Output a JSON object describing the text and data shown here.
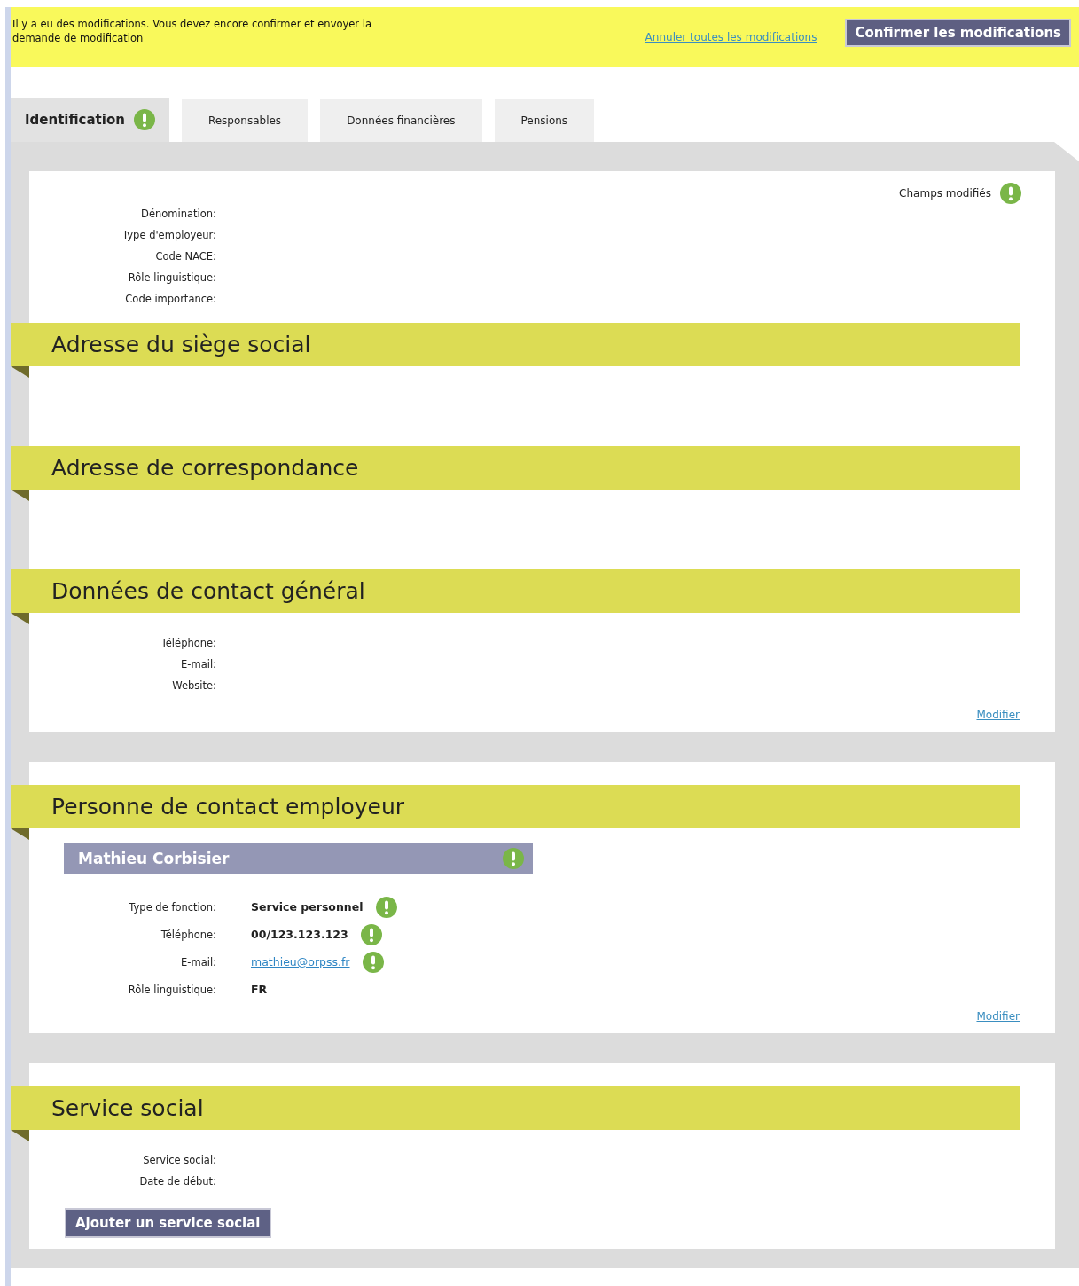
{
  "banner": {
    "message": "Il y a eu des modifications. Vous devez encore confirmer et envoyer la demande de modification",
    "cancel_link": "Annuler toutes les modifications",
    "confirm_button": "Confirmer les modifications"
  },
  "tabs": [
    {
      "label": "Identification",
      "selected": true,
      "modified": true
    },
    {
      "label": "Responsables",
      "selected": false,
      "modified": false
    },
    {
      "label": "Données financières",
      "selected": false,
      "modified": false
    },
    {
      "label": "Pensions",
      "selected": false,
      "modified": false
    }
  ],
  "cards": [
    {
      "legend": "Champs modifiés",
      "blocks": [
        {
          "kind": "fields",
          "fields": [
            {
              "label": "Dénomination:"
            },
            {
              "label": "Type d'employeur:"
            },
            {
              "label": "Code NACE:"
            },
            {
              "label": "Rôle linguistique:"
            },
            {
              "label": "Code importance:"
            }
          ]
        },
        {
          "kind": "section",
          "title": "Adresse du siège social"
        },
        {
          "kind": "section",
          "title": "Adresse de correspondance"
        },
        {
          "kind": "section",
          "title": "Données de contact général",
          "fields": [
            {
              "label": "Téléphone:"
            },
            {
              "label": "E-mail:"
            },
            {
              "label": "Website:"
            }
          ]
        }
      ],
      "modify_link": "Modifier"
    },
    {
      "blocks": [
        {
          "kind": "section",
          "title": "Personne de contact employeur",
          "person": {
            "name": "Mathieu Corbisier",
            "modified": true
          },
          "fields": [
            {
              "label": "Type de fonction:",
              "value": "Service personnel",
              "kind": "text",
              "modified": true
            },
            {
              "label": "Téléphone:",
              "value": "00/123.123.123",
              "kind": "text",
              "modified": true
            },
            {
              "label": "E-mail:",
              "value": "mathieu@orpss.fr",
              "kind": "link",
              "modified": true
            },
            {
              "label": "Rôle linguistique:",
              "value": "FR",
              "kind": "text",
              "modified": false
            }
          ]
        }
      ],
      "modify_link": "Modifier"
    },
    {
      "blocks": [
        {
          "kind": "section",
          "title": "Service social",
          "fields": [
            {
              "label": "Service social:"
            },
            {
              "label": "Date de début:"
            }
          ],
          "button": "Ajouter un service social"
        }
      ]
    }
  ]
}
